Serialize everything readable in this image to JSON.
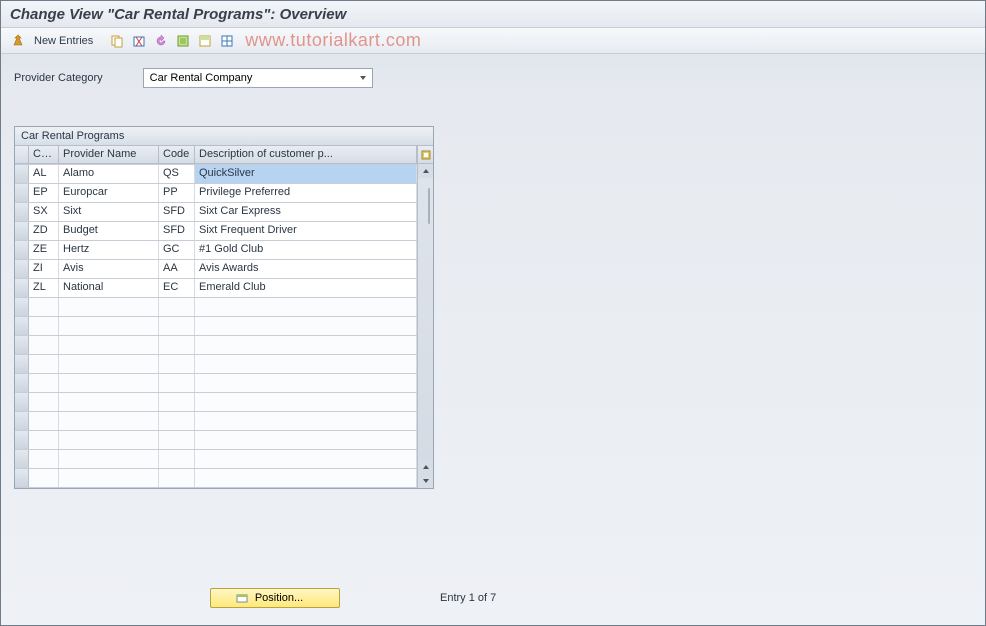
{
  "title": "Change View \"Car Rental Programs\": Overview",
  "toolbar": {
    "new_entries_label": "New Entries",
    "watermark": "www.tutorialkart.com"
  },
  "filter": {
    "label": "Provider Category",
    "value": "Car Rental Company"
  },
  "table": {
    "title": "Car Rental Programs",
    "headers": {
      "code1": "Code",
      "provider": "Provider Name",
      "code2": "Code",
      "desc": "Description of customer p..."
    },
    "rows": [
      {
        "code1": "AL",
        "provider": "Alamo",
        "code2": "QS",
        "desc": "QuickSilver"
      },
      {
        "code1": "EP",
        "provider": "Europcar",
        "code2": "PP",
        "desc": "Privilege Preferred"
      },
      {
        "code1": "SX",
        "provider": "Sixt",
        "code2": "SFD",
        "desc": "Sixt Car Express"
      },
      {
        "code1": "ZD",
        "provider": "Budget",
        "code2": "SFD",
        "desc": "Sixt Frequent Driver"
      },
      {
        "code1": "ZE",
        "provider": "Hertz",
        "code2": "GC",
        "desc": "#1 Gold Club"
      },
      {
        "code1": "ZI",
        "provider": "Avis",
        "code2": "AA",
        "desc": "Avis Awards"
      },
      {
        "code1": "ZL",
        "provider": "National",
        "code2": "EC",
        "desc": "Emerald Club"
      }
    ],
    "empty_rows": 10
  },
  "footer": {
    "position_label": "Position...",
    "entry_info": "Entry 1 of 7"
  }
}
